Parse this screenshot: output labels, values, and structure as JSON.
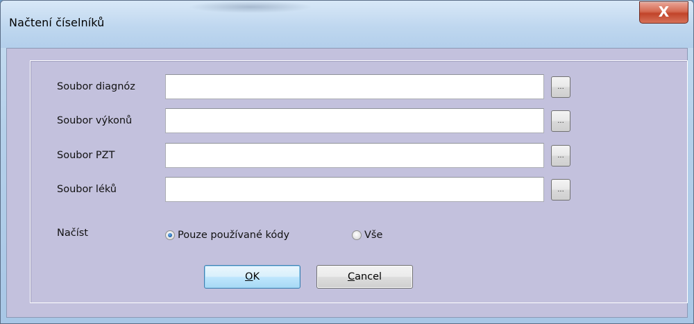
{
  "window": {
    "title": "Načtení číselníků",
    "close_glyph": "X"
  },
  "form": {
    "rows": [
      {
        "label": "Soubor diagnóz",
        "value": "",
        "browse_label": "..."
      },
      {
        "label": "Soubor výkonů",
        "value": "",
        "browse_label": "..."
      },
      {
        "label": "Soubor PZT",
        "value": "",
        "browse_label": "..."
      },
      {
        "label": "Soubor léků",
        "value": "",
        "browse_label": "..."
      }
    ],
    "load": {
      "label": "Načíst",
      "options": [
        {
          "label": "Pouze používané kódy",
          "checked": true
        },
        {
          "label": "Vše",
          "checked": false
        }
      ]
    }
  },
  "buttons": {
    "ok": {
      "mnemonic": "O",
      "rest": "K"
    },
    "cancel": {
      "mnemonic": "C",
      "rest": "ancel"
    }
  },
  "colors": {
    "client_bg": "#c3c1dd",
    "title_bg": "#bfd7ef",
    "close_red": "#c1442a",
    "ok_border": "#3c7fb1"
  }
}
